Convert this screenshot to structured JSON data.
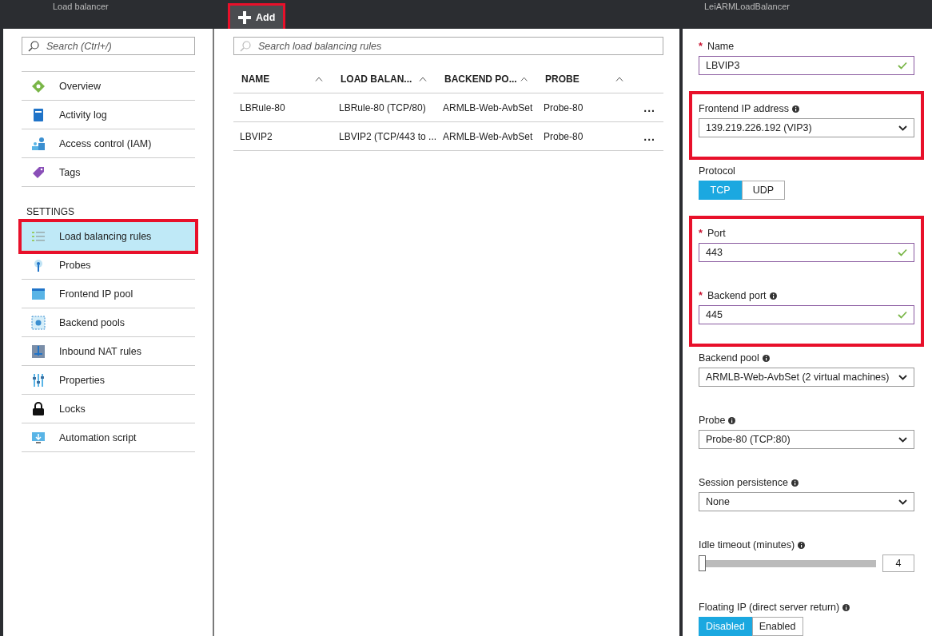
{
  "left_blade": {
    "title": "Load balancer",
    "search": {
      "placeholder": "Search (Ctrl+/)"
    },
    "sections": [
      {
        "items": [
          {
            "label": "Overview",
            "selected": false,
            "highlighted": false
          },
          {
            "label": "Activity log",
            "selected": false,
            "highlighted": false
          },
          {
            "label": "Access control (IAM)",
            "selected": false,
            "highlighted": false
          },
          {
            "label": "Tags",
            "selected": false,
            "highlighted": false
          }
        ]
      },
      {
        "heading": "SETTINGS",
        "items": [
          {
            "label": "Load balancing rules",
            "selected": true,
            "highlighted": true
          },
          {
            "label": "Probes",
            "selected": false,
            "highlighted": false
          },
          {
            "label": "Frontend IP pool",
            "selected": false,
            "highlighted": false
          },
          {
            "label": "Backend pools",
            "selected": false,
            "highlighted": false
          },
          {
            "label": "Inbound NAT rules",
            "selected": false,
            "highlighted": false
          },
          {
            "label": "Properties",
            "selected": false,
            "highlighted": false
          },
          {
            "label": "Locks",
            "selected": false,
            "highlighted": false
          },
          {
            "label": "Automation script",
            "selected": false,
            "highlighted": false
          }
        ]
      }
    ]
  },
  "rules_blade": {
    "toolbar": [
      {
        "label": "Add",
        "highlighted": true
      }
    ],
    "search": {
      "placeholder": "Search load balancing rules"
    },
    "table": {
      "columns": [
        {
          "label": "NAME"
        },
        {
          "label": "LOAD BALAN..."
        },
        {
          "label": "BACKEND PO..."
        },
        {
          "label": "PROBE"
        }
      ],
      "rows": [
        {
          "cells": [
            "LBRule-80",
            "LBRule-80 (TCP/80)",
            "ARMLB-Web-AvbSet",
            "Probe-80"
          ],
          "more": "..."
        },
        {
          "cells": [
            "LBVIP2",
            "LBVIP2 (TCP/443 to ...",
            "ARMLB-Web-AvbSet",
            "Probe-80"
          ],
          "more": "..."
        }
      ]
    }
  },
  "form_blade": {
    "title": "LeiARMLoadBalancer",
    "groups": [
      {
        "fields": [
          {
            "kind": "text",
            "label": "Name",
            "required_mark": "*",
            "value": "LBVIP3",
            "valid": true
          }
        ]
      },
      {
        "highlighted": true,
        "fields": [
          {
            "kind": "dropdown",
            "label": "Frontend IP address",
            "info": true,
            "value": "139.219.226.192 (VIP3)"
          }
        ]
      },
      {
        "fields": [
          {
            "kind": "toggle",
            "label": "Protocol",
            "options": [
              {
                "label": "TCP",
                "selected": true
              },
              {
                "label": "UDP",
                "selected": false
              }
            ]
          }
        ]
      },
      {
        "highlighted": true,
        "fields": [
          {
            "kind": "text",
            "label": "Port",
            "required_mark": "*",
            "value": "443",
            "valid": true
          },
          {
            "kind": "text",
            "label": "Backend port",
            "required_mark": "*",
            "info": true,
            "value": "445",
            "valid": true
          }
        ]
      },
      {
        "fields": [
          {
            "kind": "dropdown",
            "label": "Backend pool",
            "info": true,
            "value": "ARMLB-Web-AvbSet (2 virtual machines)"
          },
          {
            "kind": "dropdown",
            "label": "Probe",
            "info": true,
            "value": "Probe-80 (TCP:80)"
          },
          {
            "kind": "dropdown",
            "label": "Session persistence",
            "info": true,
            "value": "None"
          },
          {
            "kind": "slider",
            "label": "Idle timeout (minutes)",
            "info": true,
            "level": 0,
            "reading": "4"
          },
          {
            "kind": "toggle",
            "label": "Floating IP (direct server return)",
            "info": true,
            "options": [
              {
                "label": "Disabled",
                "selected": true
              },
              {
                "label": "Enabled",
                "selected": false
              }
            ]
          }
        ]
      }
    ]
  }
}
